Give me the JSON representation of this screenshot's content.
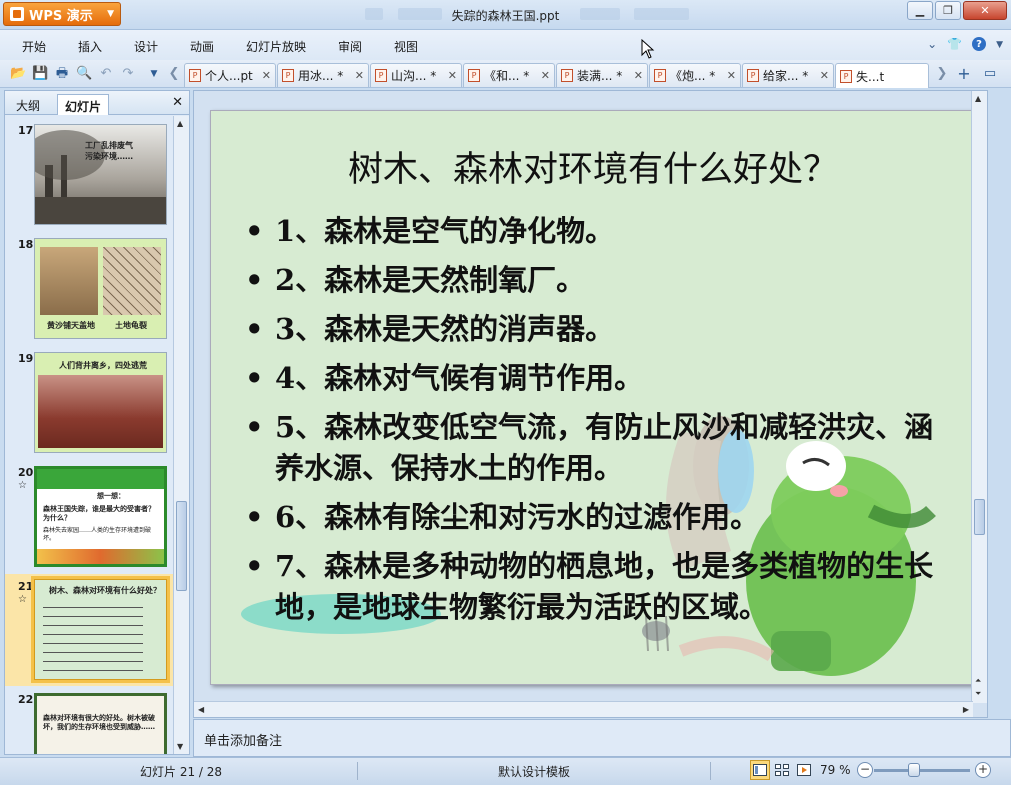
{
  "app": {
    "name": "WPS 演示",
    "doc_title": "失踪的森林王国.ppt",
    "accent": "#e56c0b"
  },
  "menu": {
    "items": [
      "开始",
      "插入",
      "设计",
      "动画",
      "幻灯片放映",
      "审阅",
      "视图"
    ]
  },
  "doc_tabs": [
    {
      "label": "个人...pt"
    },
    {
      "label": "用冰... *"
    },
    {
      "label": "山沟... *"
    },
    {
      "label": "《和... *"
    },
    {
      "label": "装满... *"
    },
    {
      "label": "《炮... *"
    },
    {
      "label": "给家... *"
    },
    {
      "label": "失...t",
      "active": true
    }
  ],
  "left_panel": {
    "tabs": [
      "大纲",
      "幻灯片"
    ],
    "active_tab": "幻灯片",
    "slides": [
      {
        "num": "17",
        "lines": [
          "工厂乱排废气",
          "污染环境……"
        ]
      },
      {
        "num": "18",
        "lines": [
          "黄沙铺天盖地",
          "土地龟裂"
        ]
      },
      {
        "num": "19",
        "lines": [
          "人们背井离乡，四处逃荒"
        ]
      },
      {
        "num": "20",
        "star": "☆",
        "lines": [
          "想一想：",
          "森林王国失踪，谁是最大的受害者？为什么？",
          "森林失去家园……人类的生存环境遭到破坏。"
        ]
      },
      {
        "num": "21",
        "star": "☆",
        "selected": true,
        "lines": [
          "树木、森林对环境有什么好处？"
        ]
      },
      {
        "num": "22",
        "lines": [
          "森林对环境有很大的好处。树木被破坏，我们的生存环境也受到威胁……"
        ]
      }
    ]
  },
  "slide": {
    "title": "树木、森林对环境有什么好处？",
    "bullets": [
      "1、森林是空气的净化物。",
      "2、森林是天然制氧厂。",
      "3、森林是天然的消声器。",
      "4、森林对气候有调节作用。",
      "5、森林改变低空气流，有防止风沙和减轻洪灾、涵养水源、保持水土的作用。",
      "6、森林有除尘和对污水的过滤作用。",
      "7、森林是多种动物的栖息地，也是多类植物的生长地，是地球生物繁衍最为活跃的区域。"
    ]
  },
  "notes": {
    "placeholder": "单击添加备注"
  },
  "status": {
    "slide_counter": "幻灯片 21 / 28",
    "template": "默认设计模板",
    "zoom": "79 %"
  }
}
